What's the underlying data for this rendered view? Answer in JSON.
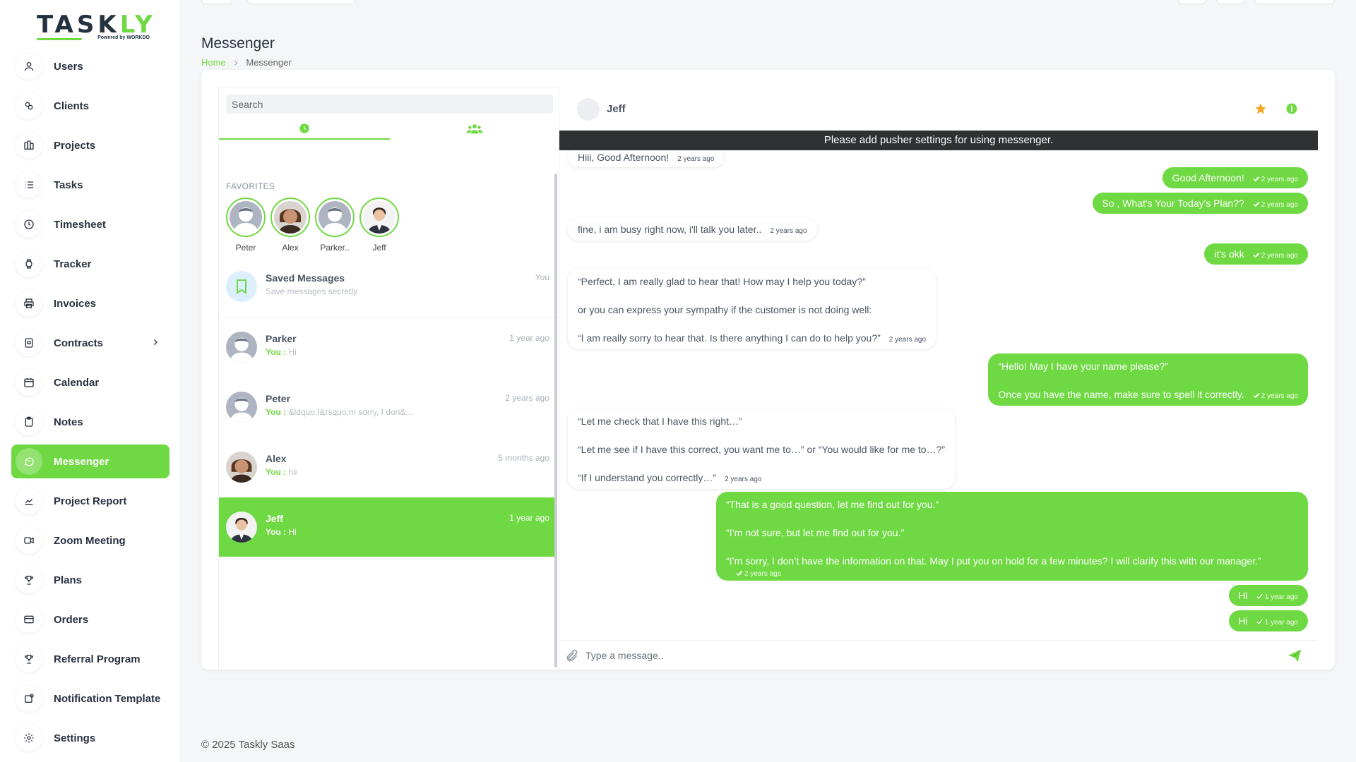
{
  "brand": {
    "logo_main": "TASK",
    "logo_accent": "LY",
    "logo_sub": "Powered by WORKDO"
  },
  "sidebar": {
    "items": [
      {
        "label": "Users",
        "icon": "user-icon"
      },
      {
        "label": "Clients",
        "icon": "clients-icon"
      },
      {
        "label": "Projects",
        "icon": "projects-icon"
      },
      {
        "label": "Tasks",
        "icon": "list-icon"
      },
      {
        "label": "Timesheet",
        "icon": "clock-icon"
      },
      {
        "label": "Tracker",
        "icon": "watch-icon"
      },
      {
        "label": "Invoices",
        "icon": "printer-icon"
      },
      {
        "label": "Contracts",
        "icon": "contract-icon"
      },
      {
        "label": "Calendar",
        "icon": "calendar-icon"
      },
      {
        "label": "Notes",
        "icon": "clipboard-icon"
      },
      {
        "label": "Messenger",
        "icon": "message-icon"
      },
      {
        "label": "Project Report",
        "icon": "chart-icon"
      },
      {
        "label": "Zoom Meeting",
        "icon": "video-icon"
      },
      {
        "label": "Plans",
        "icon": "trophy-icon"
      },
      {
        "label": "Orders",
        "icon": "card-icon"
      },
      {
        "label": "Referral Program",
        "icon": "trophy-icon"
      },
      {
        "label": "Notification Template",
        "icon": "notification-icon"
      },
      {
        "label": "Settings",
        "icon": "gear-icon"
      }
    ],
    "active": "Messenger"
  },
  "header": {
    "title": "Messenger",
    "breadcrumb_home": "Home",
    "breadcrumb_current": "Messenger"
  },
  "messenger": {
    "search_placeholder": "Search",
    "favorites_title": "FAVORITES",
    "favorites": [
      {
        "name": "Peter"
      },
      {
        "name": "Alex"
      },
      {
        "name": "Parker.."
      },
      {
        "name": "Jeff"
      }
    ],
    "saved": {
      "title": "Saved Messages",
      "subtitle": "Save messages secretly",
      "time": "You"
    },
    "contacts": [
      {
        "name": "Parker",
        "time": "1 year ago",
        "you": "You :",
        "preview": "Hi"
      },
      {
        "name": "Peter",
        "time": "2 years ago",
        "you": "You :",
        "preview": "&ldquo;I&rsquo;m sorry, I don&..."
      },
      {
        "name": "Alex",
        "time": "5 months ago",
        "you": "You :",
        "preview": "hii"
      },
      {
        "name": "Jeff",
        "time": "1 year ago",
        "you": "You :",
        "preview": "Hi"
      }
    ],
    "chat": {
      "name": "Jeff",
      "pusher_notice": "Please add pusher settings for using messenger.",
      "messages": [
        {
          "dir": "in",
          "lines": [
            "Hiii, Good Afternoon!"
          ],
          "time": "2 years ago"
        },
        {
          "dir": "out",
          "lines": [
            "Good Afternoon!"
          ],
          "time": "2 years ago"
        },
        {
          "dir": "out",
          "lines": [
            "So , What's Your Today's Plan??"
          ],
          "time": "2 years ago"
        },
        {
          "dir": "in",
          "lines": [
            "fine, i am busy right now, i'll talk you later.."
          ],
          "time": "2 years ago"
        },
        {
          "dir": "out",
          "lines": [
            "it's okk"
          ],
          "time": "2 years ago"
        },
        {
          "dir": "in",
          "lines": [
            "“Perfect, I am really glad to hear that! How may I help you today?”",
            "or you can express your sympathy if the customer is not doing well:",
            "“I am really sorry to hear that. Is there anything I can do to help you?”"
          ],
          "time": "2 years ago"
        },
        {
          "dir": "out",
          "lines": [
            "“Hello! May I have your name please?”",
            "Once you have the name, make sure to spell it correctly."
          ],
          "time": "2 years ago"
        },
        {
          "dir": "in",
          "lines": [
            "“Let me check that I have this right…”",
            "“Let me see if I have this correct, you want me to…” or “You would like for me to…?”",
            "“If I understand you correctly…”"
          ],
          "time": "2 years ago"
        },
        {
          "dir": "out",
          "lines": [
            "“That is a good question, let me find out for you.”",
            "“I’m not sure, but let me find out for you.”",
            "“I’m sorry, I don’t have the information on that. May I put you on hold for a few minutes? I will clarify this with our manager.”"
          ],
          "time": "2 years ago"
        },
        {
          "dir": "out",
          "lines": [
            "Hi"
          ],
          "time": "1 year ago"
        },
        {
          "dir": "out",
          "lines": [
            "Hi"
          ],
          "time": "1 year ago"
        }
      ],
      "composer_placeholder": "Type a message.."
    }
  },
  "footer": {
    "text": "© 2025 Taskly Saas"
  },
  "colors": {
    "accent": "#6fd943",
    "dark_bar": "#2f3133",
    "star": "#f5a623"
  }
}
